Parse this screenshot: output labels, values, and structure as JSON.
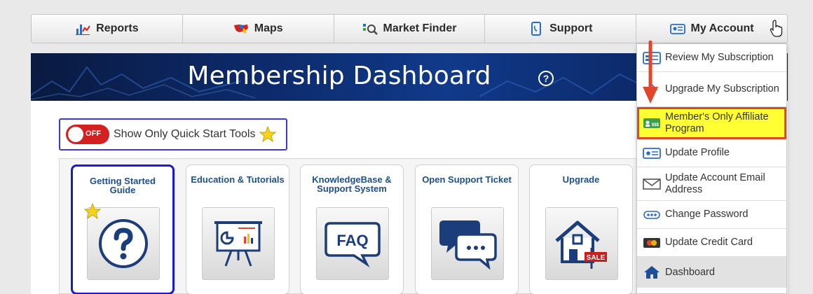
{
  "nav": {
    "items": [
      {
        "label": "Reports",
        "icon": "reports-chart-icon"
      },
      {
        "label": "Maps",
        "icon": "us-map-icon"
      },
      {
        "label": "Market Finder",
        "icon": "market-finder-icon"
      },
      {
        "label": "Support",
        "icon": "phone-icon"
      },
      {
        "label": "My Account",
        "icon": "account-card-icon"
      }
    ]
  },
  "banner": {
    "title": "Membership Dashboard",
    "help_symbol": "?"
  },
  "quick_start": {
    "switch_state": "OFF",
    "label": "Show Only Quick Start Tools"
  },
  "cards": [
    {
      "title": "Getting Started Guide",
      "icon": "question-icon"
    },
    {
      "title": "Education & Tutorials",
      "icon": "presentation-board-icon"
    },
    {
      "title": "KnowledgeBase & Support System",
      "icon": "faq-bubble-icon"
    },
    {
      "title": "Open Support Ticket",
      "icon": "chat-bubbles-icon"
    },
    {
      "title": "Upgrade",
      "icon": "house-sale-icon"
    }
  ],
  "account_menu": {
    "items": [
      {
        "label": "Review My Subscription",
        "icon": "subscription-icon"
      },
      {
        "label": "Upgrade My Subscription",
        "icon": "upgrade-icon"
      },
      {
        "label": "Member's Only Affiliate Program",
        "icon": "affiliate-card-icon"
      },
      {
        "label": "Update Profile",
        "icon": "profile-card-icon"
      },
      {
        "label": "Update Account Email Address",
        "icon": "envelope-icon"
      },
      {
        "label": "Change Password",
        "icon": "password-icon"
      },
      {
        "label": "Update Credit Card",
        "icon": "credit-card-icon"
      },
      {
        "label": "Dashboard",
        "icon": "home-icon"
      }
    ]
  },
  "colors": {
    "highlight": "#ffff33",
    "highlight_border": "#e0472a",
    "card_title": "#1e4f8a",
    "switch_off": "#d42020"
  }
}
